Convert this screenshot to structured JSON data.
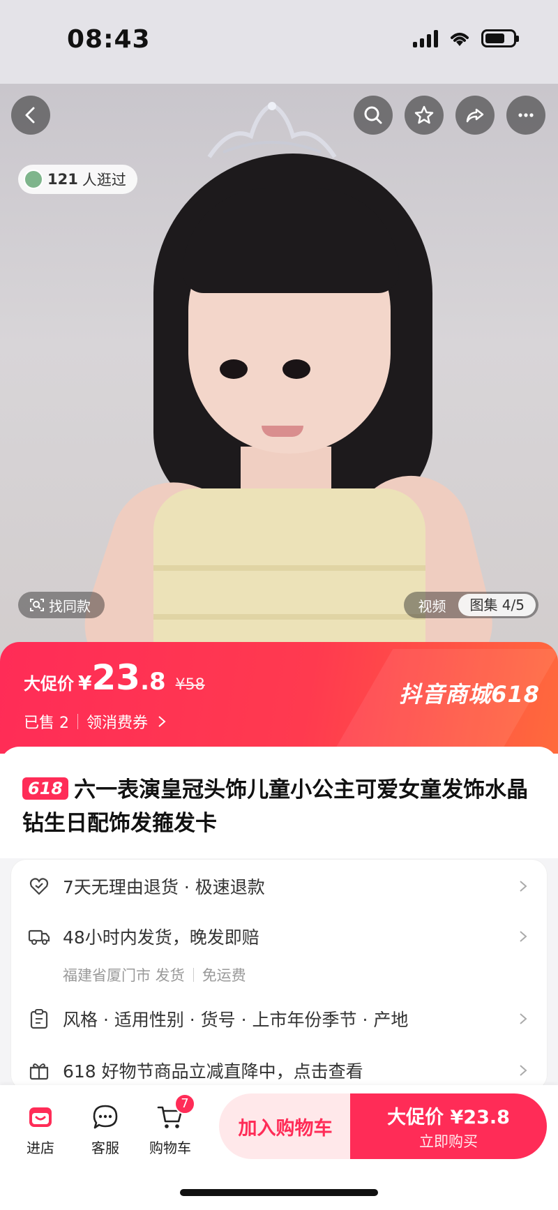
{
  "status_bar": {
    "time": "08:43"
  },
  "hero": {
    "viewers_count": "121",
    "viewers_label": "人逛过",
    "find_same_label": "找同款",
    "media_tabs": {
      "video": "视频",
      "gallery": "图集 4/5"
    }
  },
  "price": {
    "label": "大促价",
    "currency": "¥",
    "integer": "23",
    "decimal": ".8",
    "original": "¥58",
    "sold": "已售 2",
    "coupon": "领消费券",
    "brand": "抖音商城618"
  },
  "product": {
    "badge": "618",
    "title": "六一表演皇冠头饰儿童小公主可爱女童发饰水晶钻生日配饰发箍发卡"
  },
  "services": {
    "return_policy": "7天无理由退货 · 极速退款",
    "shipping": "48小时内发货，晚发即赔",
    "ship_from": "福建省厦门市 发货",
    "free_shipping": "免运费",
    "attributes": "风格 · 适用性别 · 货号 · 上市年份季节 · 产地",
    "promo": "618 好物节商品立减直降中，点击查看"
  },
  "bottom_bar": {
    "store": "进店",
    "service": "客服",
    "cart": "购物车",
    "cart_count": "7",
    "add_to_cart": "加入购物车",
    "buy_price": "大促价 ¥23.8",
    "buy_now": "立即购买"
  },
  "colors": {
    "accent": "#ff2c57",
    "accent_light": "#ffe8ea"
  }
}
